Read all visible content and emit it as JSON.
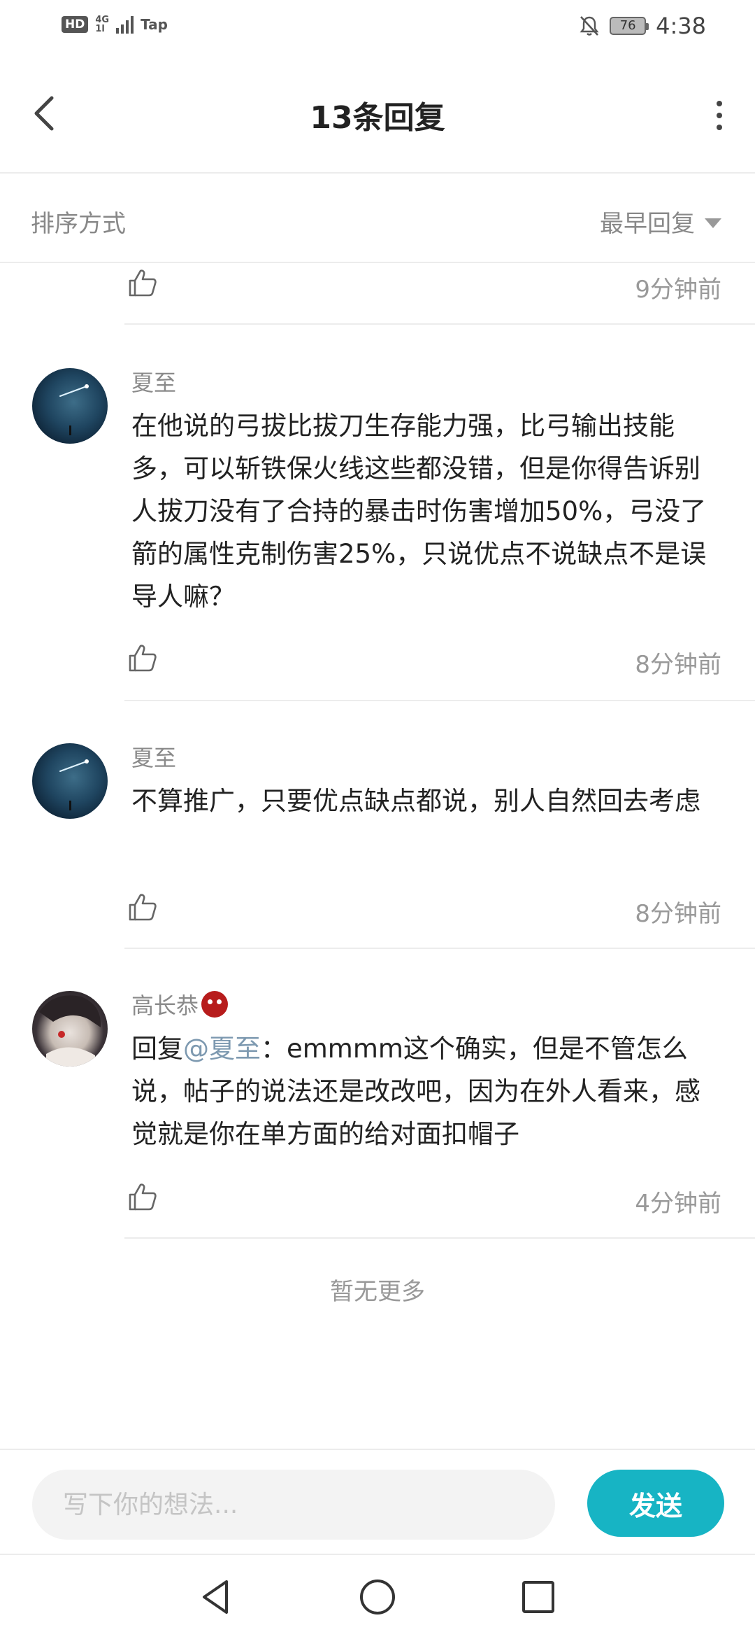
{
  "status_bar": {
    "hd": "HD",
    "network": "4G",
    "network_sub": "1l",
    "carrier_app": "Tap",
    "battery": "76",
    "time": "4:38"
  },
  "header": {
    "title": "13条回复"
  },
  "sort": {
    "label": "排序方式",
    "value": "最早回复"
  },
  "partial_comment": {
    "time": "9分钟前"
  },
  "comments": [
    {
      "username": "夏至",
      "text": "在他说的弓拔比拔刀生存能力强，比弓输出技能多，可以斩铁保火线这些都没错，但是你得告诉别人拔刀没有了合持的暴击时伤害增加50%，弓没了箭的属性克制伤害25%，只说优点不说缺点不是误导人嘛？",
      "time": "8分钟前"
    },
    {
      "username": "夏至",
      "text": "不算推广，只要优点缺点都说，别人自然回去考虑",
      "time": "8分钟前"
    },
    {
      "username": "高长恭",
      "reply_prefix": "回复",
      "mention": "@夏至",
      "text": "：emmmm这个确实，但是不管怎么说，帖子的说法还是改改吧，因为在外人看来，感觉就是你在单方面的给对面扣帽子",
      "time": "4分钟前"
    }
  ],
  "no_more": "暂无更多",
  "input_bar": {
    "placeholder": "写下你的想法...",
    "send_label": "发送"
  },
  "colors": {
    "accent": "#17b4c4",
    "mention": "#7d99b0",
    "secondary_text": "#999999"
  },
  "icons": {
    "back": "chevron-left-icon",
    "more": "more-vertical-icon",
    "sort": "triangle-down-icon",
    "like": "thumbs-up-icon",
    "nav_back": "nav-back-triangle-icon",
    "nav_home": "nav-home-circle-icon",
    "nav_recents": "nav-recents-square-icon"
  }
}
